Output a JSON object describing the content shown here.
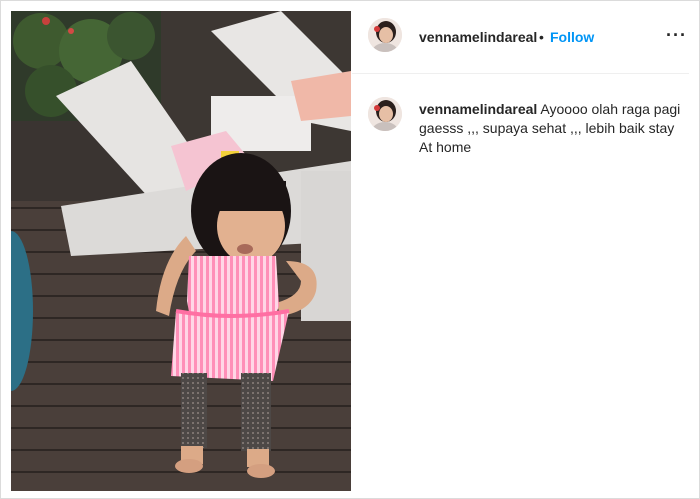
{
  "post": {
    "username": "vennamelindareal",
    "dot": "•",
    "follow_label": "Follow",
    "more_label": "···"
  },
  "caption": {
    "username": "vennamelindareal",
    "text": "Ayoooo olah raga pagi gaesss ,,, supaya sehat ,,, lebih baik stay At home"
  },
  "icons": {
    "more": "more-options-icon",
    "avatar": "profile-avatar"
  },
  "colors": {
    "follow": "#0095f6",
    "text": "#262626",
    "divider": "#efefef"
  }
}
